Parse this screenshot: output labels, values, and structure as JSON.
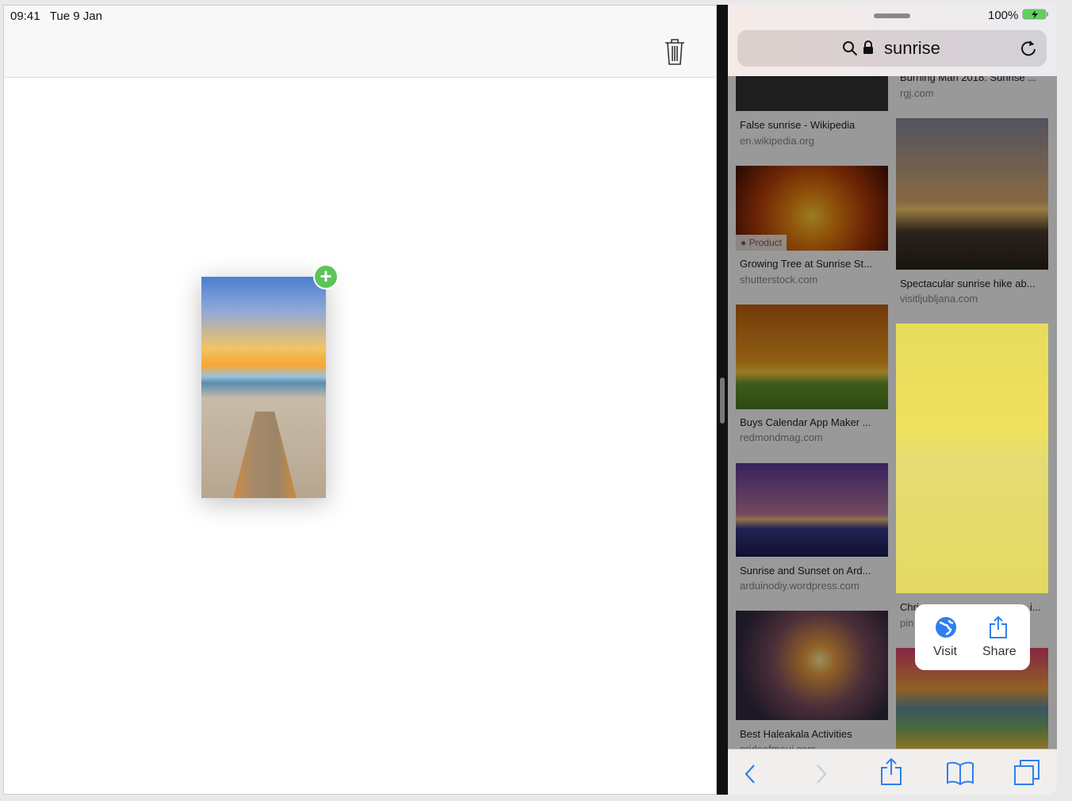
{
  "status": {
    "time": "09:41",
    "date": "Tue 9 Jan",
    "battery": "100%"
  },
  "browser": {
    "query": "sunrise"
  },
  "results": {
    "left": [
      {
        "title": "False sunrise - Wikipedia",
        "source": "en.wikipedia.org"
      },
      {
        "title": "Growing Tree at Sunrise St...",
        "source": "shutterstock.com",
        "badge": "Product"
      },
      {
        "title": "Buys Calendar App Maker ...",
        "source": "redmondmag.com"
      },
      {
        "title": "Sunrise and Sunset on Ard...",
        "source": "arduinodiy.wordpress.com"
      },
      {
        "title": "Best Haleakala Activities",
        "source": "prideofmaui.com"
      }
    ],
    "right": [
      {
        "title": "Burning Man 2018: Sunrise ...",
        "source": "rgj.com"
      },
      {
        "title": "Spectacular sunrise hike ab...",
        "source": "visitljubljana.com"
      },
      {
        "title": "Chri...",
        "title_end": "...i...",
        "source": "pin"
      }
    ]
  },
  "popup": {
    "visit": "Visit",
    "share": "Share"
  },
  "colors": {
    "accent": "#2f7ef0",
    "add": "#5ec45a"
  }
}
